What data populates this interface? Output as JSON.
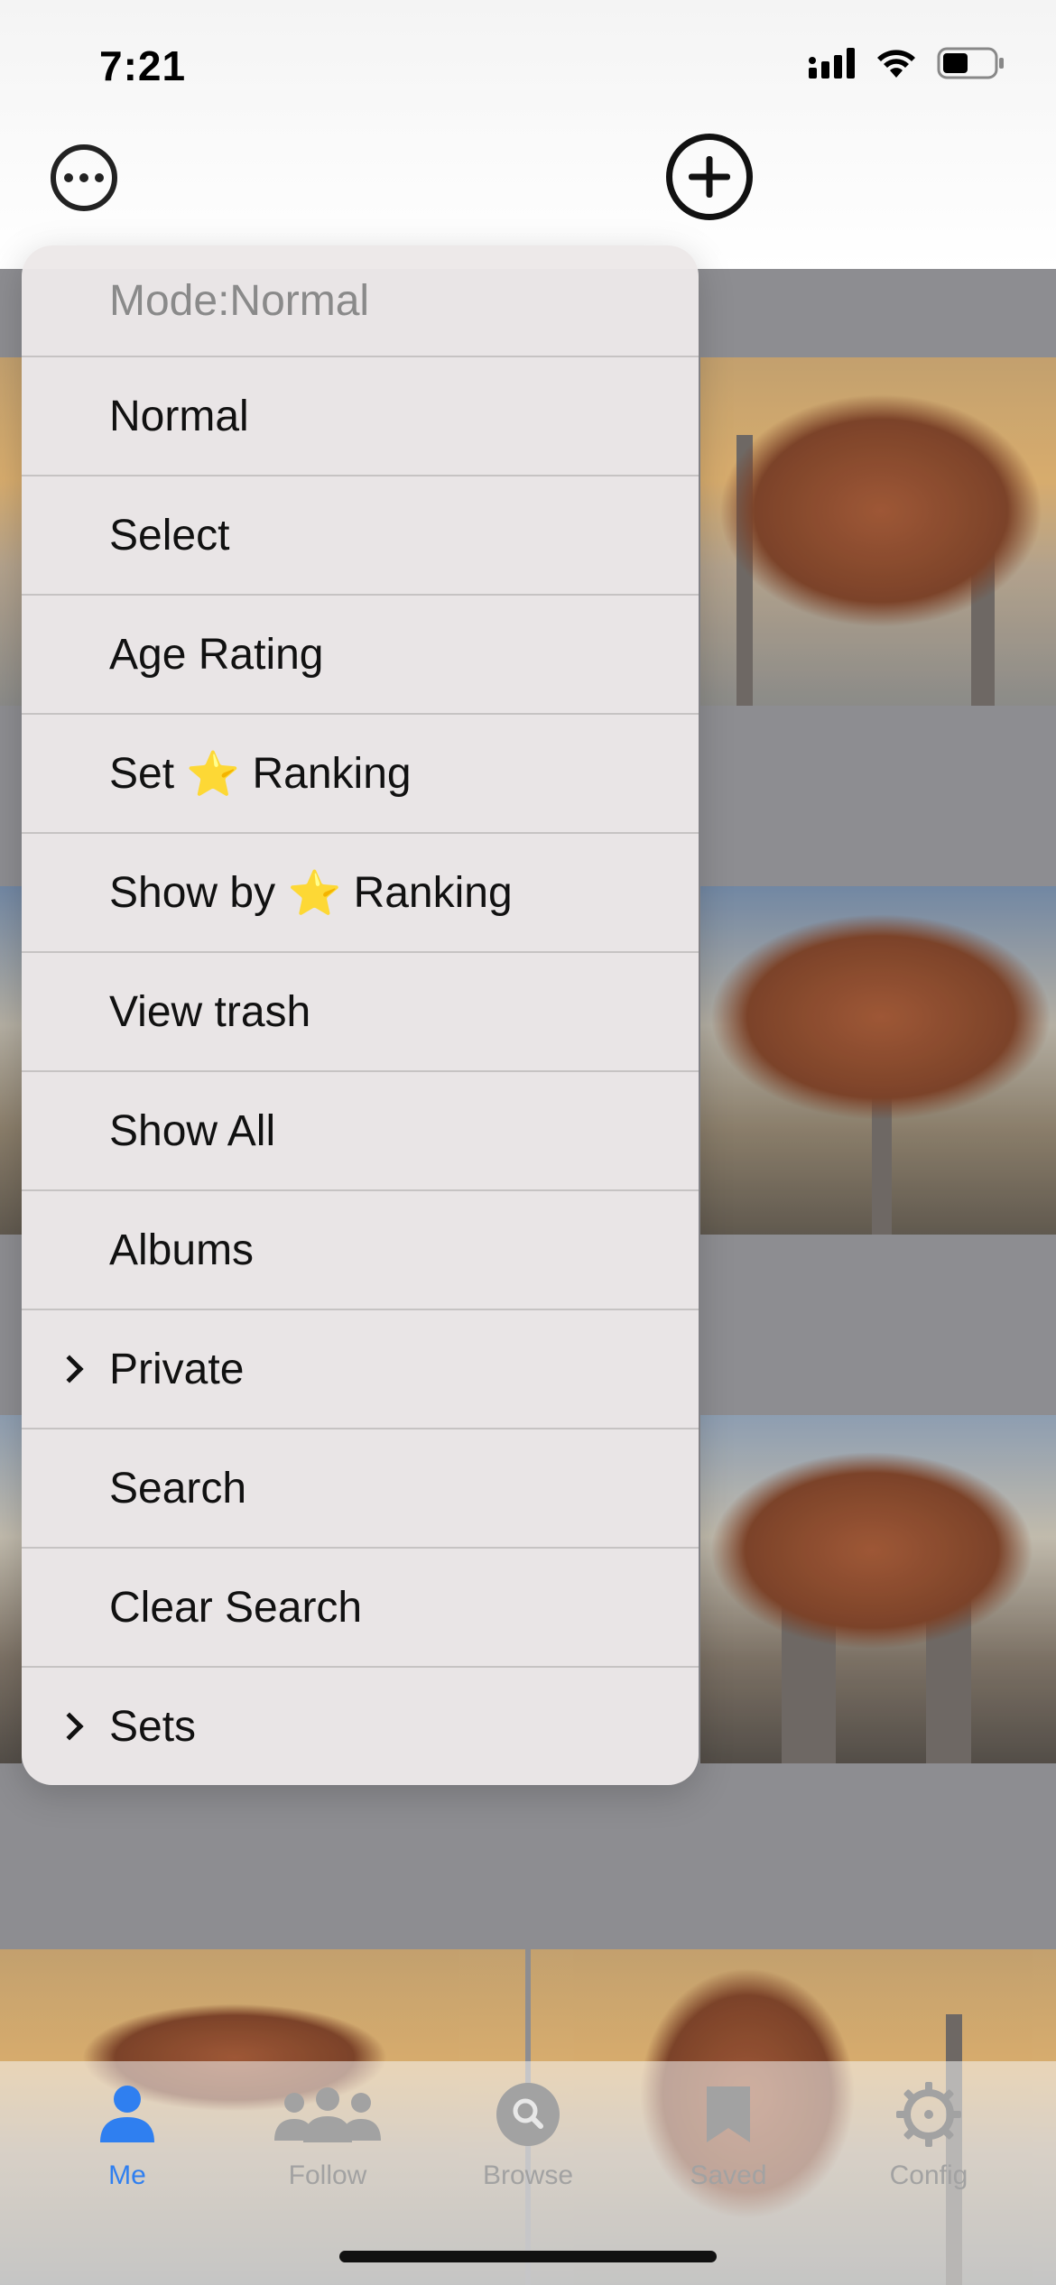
{
  "status_bar": {
    "time": "7:21",
    "battery_level": 0.5
  },
  "menu": {
    "header": "Mode:Normal",
    "items": [
      {
        "label": "Normal",
        "has_submenu": false
      },
      {
        "label": "Select",
        "has_submenu": false
      },
      {
        "label": "Age Rating",
        "has_submenu": false
      },
      {
        "label_before": "Set",
        "label_after": "Ranking",
        "icon": "star-icon",
        "star": "⭐",
        "has_submenu": false
      },
      {
        "label_before": "Show by",
        "label_after": "Ranking",
        "icon": "star-icon",
        "star": "⭐",
        "has_submenu": false
      },
      {
        "label": "View trash",
        "has_submenu": false
      },
      {
        "label": "Show All",
        "has_submenu": false
      },
      {
        "label": "Albums",
        "has_submenu": false
      },
      {
        "label": "Private",
        "has_submenu": true
      },
      {
        "label": "Search",
        "has_submenu": false
      },
      {
        "label": "Clear Search",
        "has_submenu": false
      },
      {
        "label": "Sets",
        "has_submenu": true
      }
    ]
  },
  "tabs": [
    {
      "label": "Me",
      "icon": "person-icon",
      "active": true
    },
    {
      "label": "Follow",
      "icon": "people-icon",
      "active": false
    },
    {
      "label": "Browse",
      "icon": "search-icon",
      "active": false
    },
    {
      "label": "Saved",
      "icon": "saved-icon",
      "active": false
    },
    {
      "label": "Config",
      "icon": "gear-icon",
      "active": false
    }
  ],
  "colors": {
    "accent": "#2f7ff0",
    "inactive_tab": "#a2a2a2",
    "star": "#f2c230"
  }
}
